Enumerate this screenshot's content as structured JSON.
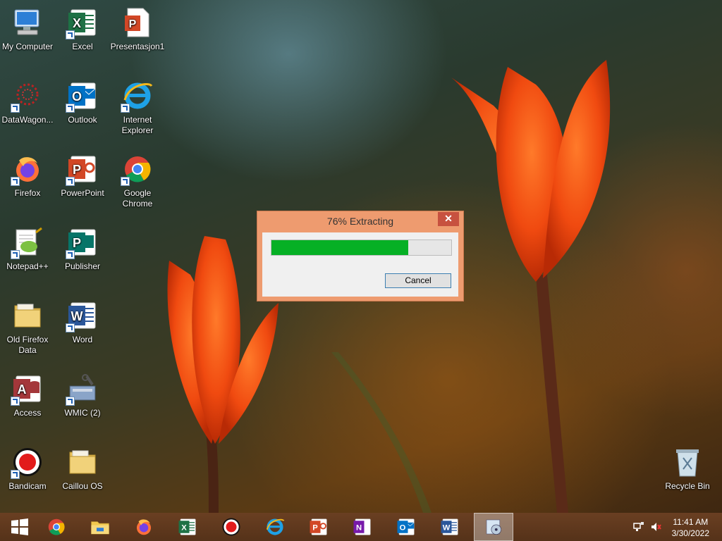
{
  "desktop": {
    "icons": [
      {
        "label": "My Computer",
        "icon": "my-computer-icon"
      },
      {
        "label": "Excel",
        "icon": "excel-icon"
      },
      {
        "label": "Presentasjon1",
        "icon": "pptx-file-icon"
      },
      {
        "label": "DataWagon...",
        "icon": "datawagon-icon"
      },
      {
        "label": "Outlook",
        "icon": "outlook-icon"
      },
      {
        "label": "Internet Explorer",
        "icon": "internet-explorer-icon"
      },
      {
        "label": "Firefox",
        "icon": "firefox-icon"
      },
      {
        "label": "PowerPoint",
        "icon": "powerpoint-icon"
      },
      {
        "label": "Google Chrome",
        "icon": "chrome-icon"
      },
      {
        "label": "Notepad++",
        "icon": "notepadpp-icon"
      },
      {
        "label": "Publisher",
        "icon": "publisher-icon"
      },
      {
        "label": "Old Firefox Data",
        "icon": "folder-icon"
      },
      {
        "label": "Word",
        "icon": "word-icon"
      },
      {
        "label": "Access",
        "icon": "access-icon"
      },
      {
        "label": "WMIC (2)",
        "icon": "wmic-icon"
      },
      {
        "label": "Bandicam",
        "icon": "bandicam-icon"
      },
      {
        "label": "Caillou OS",
        "icon": "folder-icon"
      },
      {
        "label": "Recycle Bin",
        "icon": "recycle-bin-icon"
      }
    ]
  },
  "dialog": {
    "title": "76% Extracting",
    "progress_percent": 76,
    "cancel_label": "Cancel",
    "close_glyph": "✕",
    "progress_color": "#06b025"
  },
  "taskbar": {
    "items": [
      "start-icon",
      "chrome-icon",
      "file-explorer-icon",
      "firefox-icon",
      "excel-icon",
      "bandicam-icon",
      "internet-explorer-icon",
      "powerpoint-icon",
      "onenote-icon",
      "outlook-icon",
      "word-icon",
      "extract-app-icon"
    ],
    "clock": {
      "time": "11:41 AM",
      "date": "3/30/2022"
    }
  }
}
